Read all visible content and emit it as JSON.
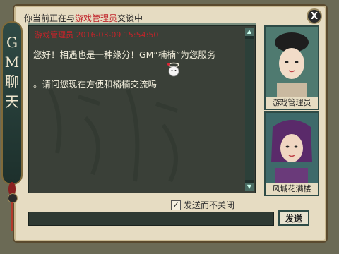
{
  "title": {
    "prefix": "你当前正在与",
    "highlight": "游戏管理员",
    "suffix": "交谈中"
  },
  "close_label": "X",
  "side_banner": [
    "G",
    "M",
    "聊",
    "天"
  ],
  "chat": {
    "header": "游戏管理员  2016-03-09 15:54:50",
    "lines": [
      "您好！相遇也是一种缘分！GM“楠楠”为您服务",
      "。请问您现在方便和楠楠交流吗"
    ],
    "background_glyphs": "流离 春 轻 水 寿 梦"
  },
  "portraits": [
    {
      "name": "游戏管理员"
    },
    {
      "name": "风城花满楼"
    }
  ],
  "checkbox": {
    "label": "发送而不关闭",
    "checked": true
  },
  "send_label": "发送"
}
